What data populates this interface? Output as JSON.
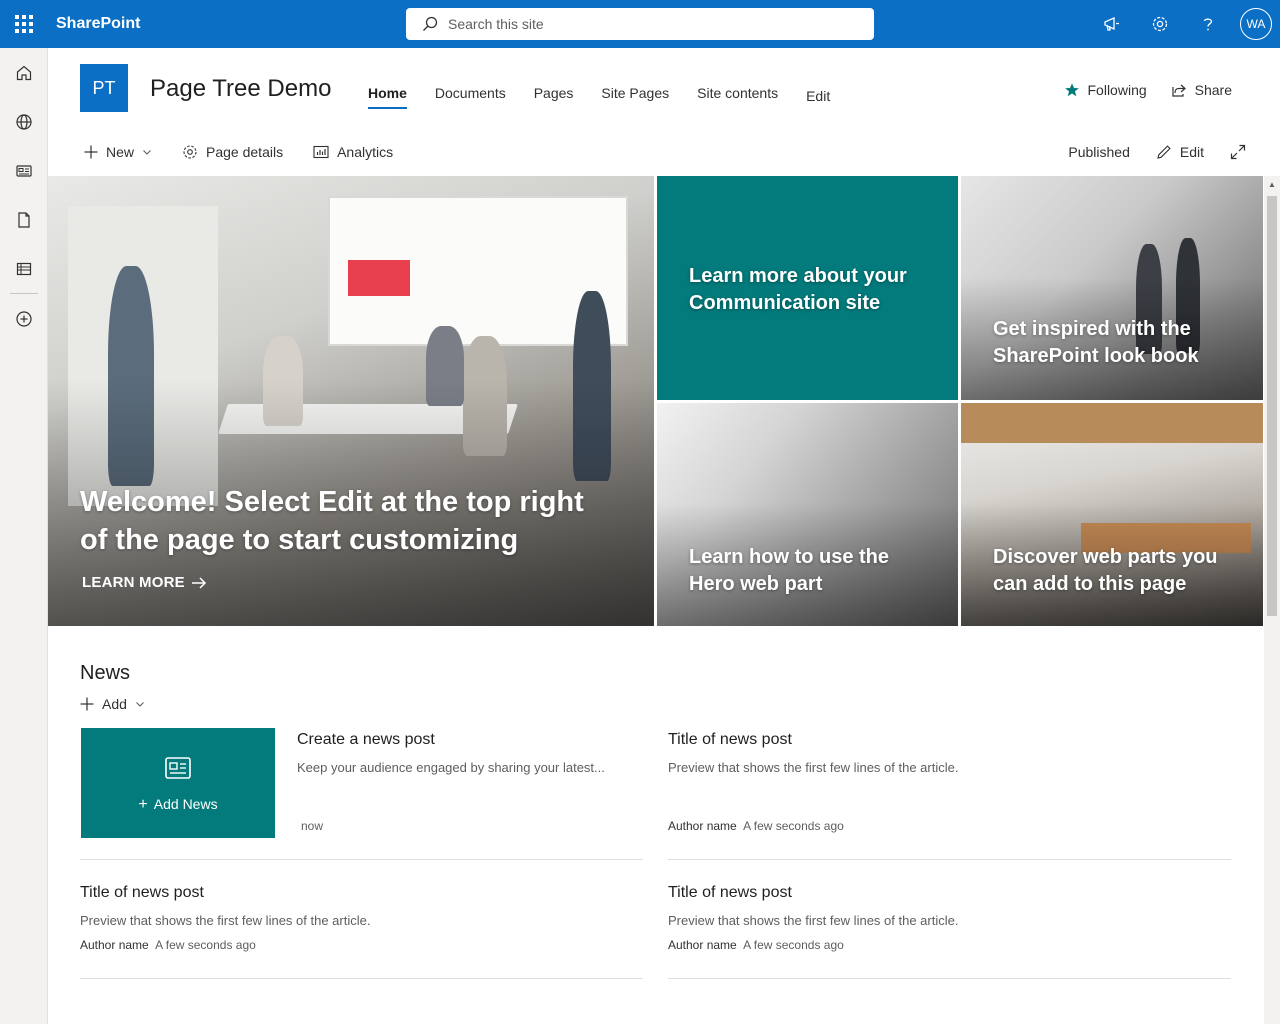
{
  "suitebar": {
    "app_name": "SharePoint",
    "search_placeholder": "Search this site",
    "avatar_initials": "WA"
  },
  "site": {
    "logo_text": "PT",
    "title": "Page Tree Demo"
  },
  "nav": {
    "items": [
      "Home",
      "Documents",
      "Pages",
      "Site Pages",
      "Site contents"
    ],
    "edit": "Edit"
  },
  "header_actions": {
    "following": "Following",
    "share": "Share"
  },
  "commandbar": {
    "new": "New",
    "page_details": "Page details",
    "analytics": "Analytics",
    "status": "Published",
    "edit": "Edit"
  },
  "hero": {
    "main_title": "Welcome! Select Edit at the top right of the page to start customizing",
    "main_link": "LEARN MORE",
    "tile_teal": "Learn more about your Communication site",
    "tile_look": "Get inspired with the SharePoint look book",
    "tile_hero": "Learn how to use the Hero web part",
    "tile_disc": "Discover web parts you can add to this page"
  },
  "news": {
    "title": "News",
    "add": "Add",
    "add_news_label": "Add News",
    "create_post": {
      "title": "Create a news post",
      "preview": "Keep your audience engaged by sharing your latest...",
      "time": "now"
    },
    "posts": [
      {
        "title": "Title of news post",
        "preview": "Preview that shows the first few lines of the article.",
        "author": "Author name",
        "time": "A few seconds ago"
      },
      {
        "title": "Title of news post",
        "preview": "Preview that shows the first few lines of the article.",
        "author": "Author name",
        "time": "A few seconds ago"
      },
      {
        "title": "Title of news post",
        "preview": "Preview that shows the first few lines of the article.",
        "author": "Author name",
        "time": "A few seconds ago"
      }
    ]
  },
  "colors": {
    "suitebar": "#0b6fc6",
    "teal": "#037a7b",
    "following_star": "#037a7b"
  }
}
